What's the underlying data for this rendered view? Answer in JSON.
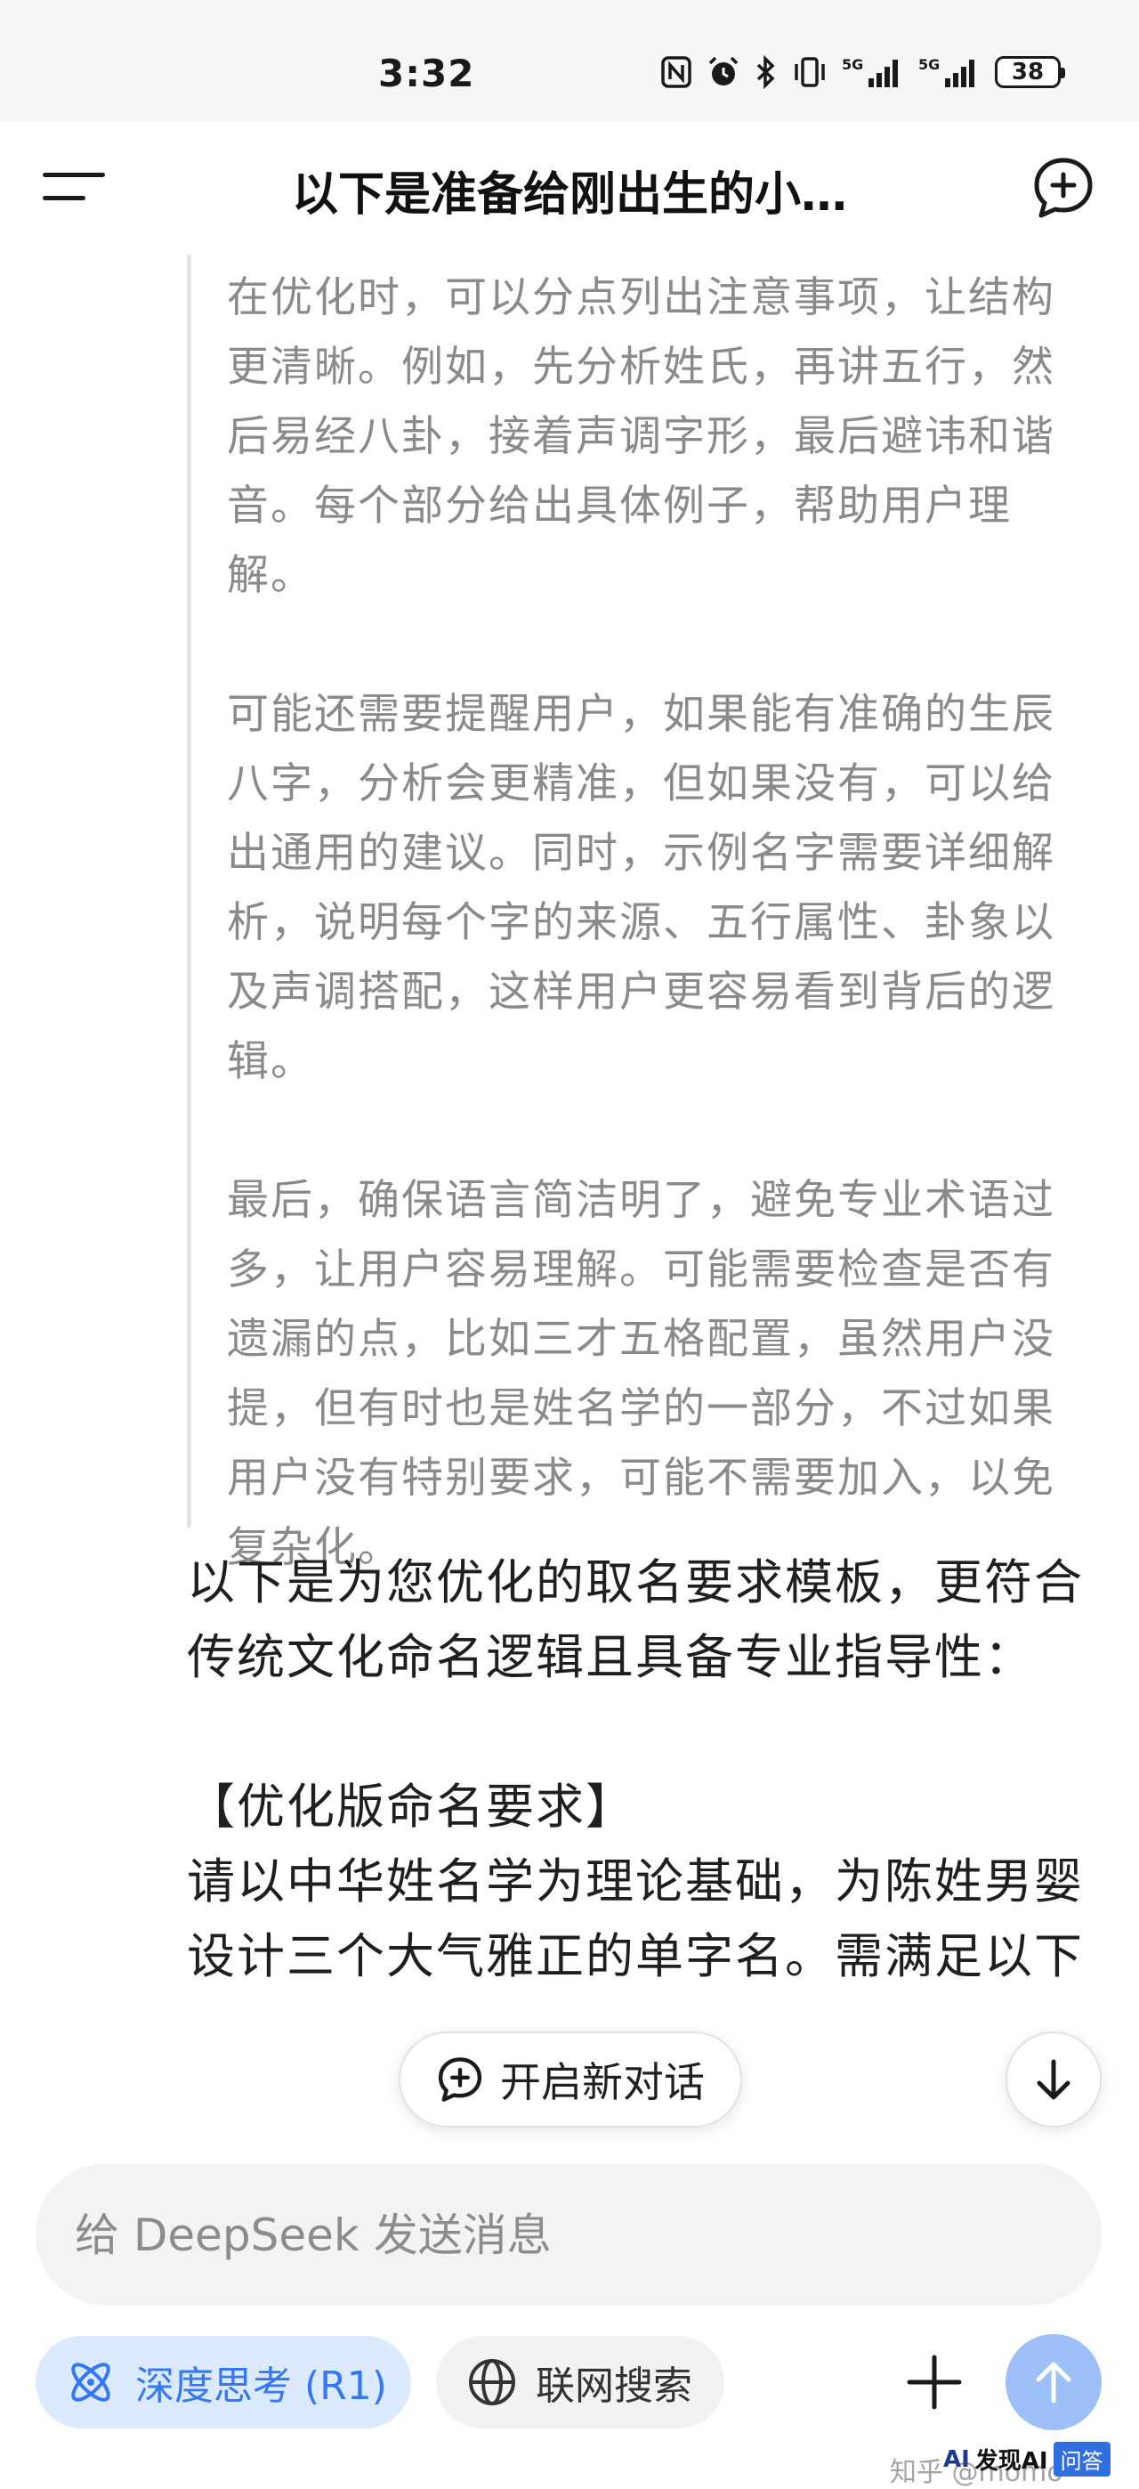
{
  "status_bar": {
    "time": "3:32",
    "battery": "38",
    "icons": [
      "nfc-icon",
      "alarm-icon",
      "bluetooth-icon",
      "vibrate-icon",
      "signal-5g-icon",
      "signal-5g-icon"
    ]
  },
  "header": {
    "title": "以下是准备给刚出生的小…"
  },
  "thinking": {
    "paragraphs": [
      "在优化时，可以分点列出注意事项，让结构更清晰。例如，先分析姓氏，再讲五行，然后易经八卦，接着声调字形，最后避讳和谐音。每个部分给出具体例子，帮助用户理解。",
      "可能还需要提醒用户，如果能有准确的生辰八字，分析会更精准，但如果没有，可以给出通用的建议。同时，示例名字需要详细解析，说明每个字的来源、五行属性、卦象以及声调搭配，这样用户更容易看到背后的逻辑。",
      "最后，确保语言简洁明了，避免专业术语过多，让用户容易理解。可能需要检查是否有遗漏的点，比如三才五格配置，虽然用户没提，但有时也是姓名学的一部分，不过如果用户没有特别要求，可能不需要加入，以免复杂化。"
    ]
  },
  "answer": {
    "intro": "以下是为您优化的取名要求模板，更符合传统文化命名逻辑且具备专业指导性：",
    "heading": "【优化版命名要求】",
    "body": "请以中华姓名学为理论基础，为陈姓男婴设计三个大气雅正的单字名。需满足以下"
  },
  "floating": {
    "new_dialog_label": "开启新对话"
  },
  "composer": {
    "placeholder": "给 DeepSeek 发送消息"
  },
  "toolbar": {
    "deep_think_label": "深度思考 (R1)",
    "web_search_label": "联网搜索"
  },
  "watermark": {
    "text": "知乎 @momo",
    "badge_ai": "AI",
    "badge_faxian": "发现AI",
    "badge_wenda": "问答"
  },
  "colors": {
    "accent": "#3478f6",
    "accent_bg": "#dbeafe",
    "send_button": "#9ec0f8",
    "thinking_text": "#8a8a8a"
  }
}
